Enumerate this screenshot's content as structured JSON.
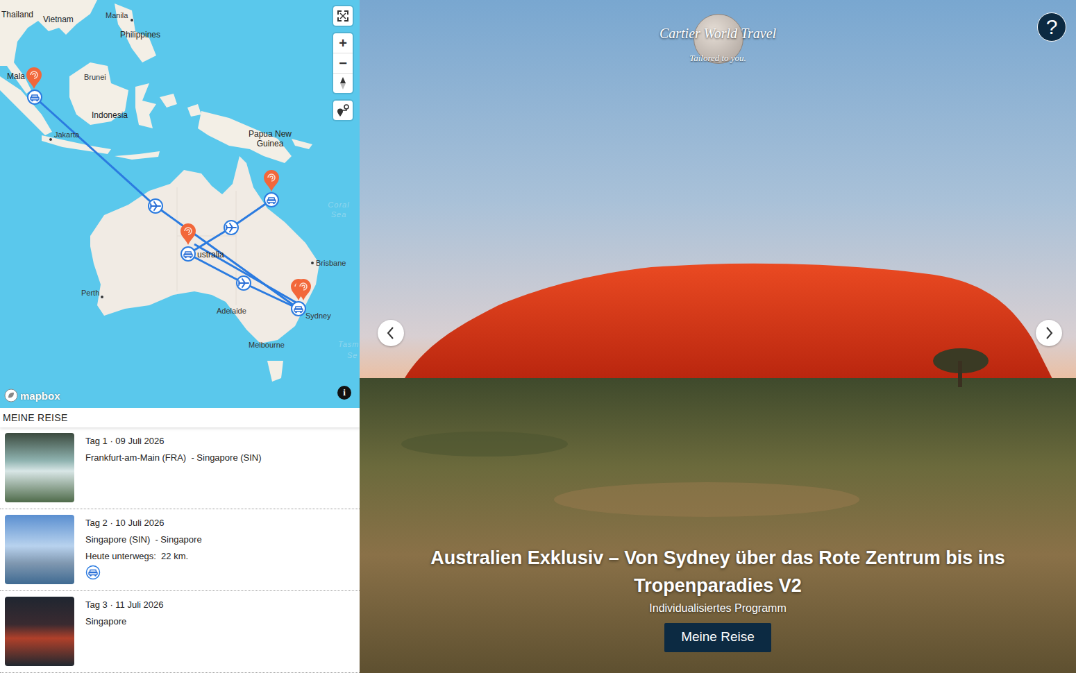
{
  "map": {
    "labels": [
      {
        "text": "Thailand",
        "kind": "country"
      },
      {
        "text": "Vietnam",
        "kind": "country"
      },
      {
        "text": "Manila",
        "kind": "city"
      },
      {
        "text": "Philippines",
        "kind": "country"
      },
      {
        "text": "Mala",
        "kind": "country"
      },
      {
        "text": "Brunei",
        "kind": "place"
      },
      {
        "text": "Indonesia",
        "kind": "country"
      },
      {
        "text": "Jakarta",
        "kind": "city"
      },
      {
        "text": "Papua New Guinea",
        "kind": "country"
      },
      {
        "text": "Coral Sea",
        "kind": "water"
      },
      {
        "text": "Brisbane",
        "kind": "city"
      },
      {
        "text": "Perth",
        "kind": "city"
      },
      {
        "text": "ustralia",
        "kind": "country"
      },
      {
        "text": "Adelaide",
        "kind": "place"
      },
      {
        "text": "Sydney",
        "kind": "place"
      },
      {
        "text": "Melbourne",
        "kind": "place"
      },
      {
        "text": "Tasm",
        "kind": "water"
      },
      {
        "text": "Se",
        "kind": "water"
      }
    ],
    "markers": [
      {
        "kind": "car"
      },
      {
        "kind": "plane"
      },
      {
        "kind": "car"
      },
      {
        "kind": "plane"
      },
      {
        "kind": "car"
      },
      {
        "kind": "plane"
      },
      {
        "kind": "car"
      }
    ],
    "controls": {
      "zoom_in": "+",
      "zoom_out": "−",
      "info": "i"
    },
    "attribution": "mapbox"
  },
  "itinerary": {
    "heading": "MEINE REISE",
    "days": [
      {
        "date": "Tag 1 · 09 Juli 2026",
        "route": "Frankfurt-am-Main (FRA)  - Singapore (SIN)"
      },
      {
        "date": "Tag 2 · 10 Juli 2026",
        "route": "Singapore (SIN)  - Singapore",
        "distance": "Heute unterwegs:  22 km.",
        "transport": [
          {
            "kind": "car"
          }
        ]
      },
      {
        "date": "Tag 3 · 11 Juli 2026",
        "route": "Singapore"
      }
    ]
  },
  "hero": {
    "brand": "Cartier World Travel",
    "tagline": "Tailored to you.",
    "title": "Australien Exklusiv – Von Sydney über das Rote Zentrum bis ins Tropenparadies V2",
    "subtitle": "Individualisiertes Programm",
    "button": "Meine Reise",
    "help": "?"
  }
}
